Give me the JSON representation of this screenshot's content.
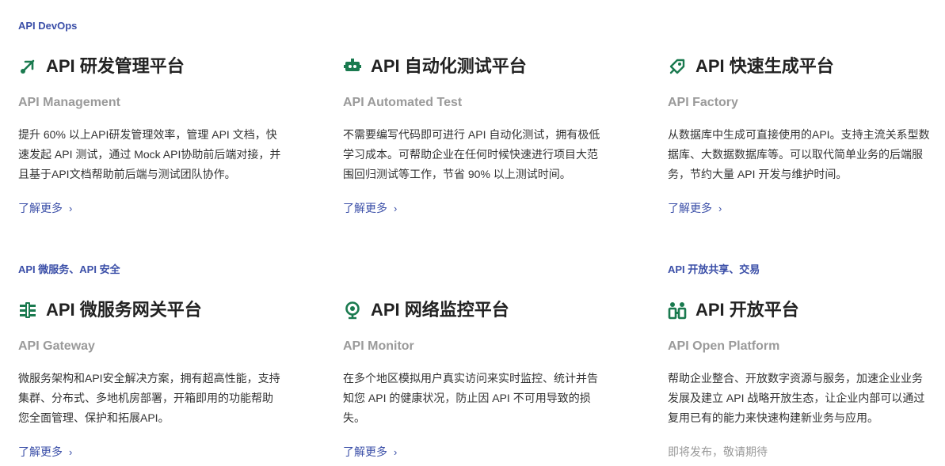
{
  "colors": {
    "accent": "#3b4fa8",
    "icon_green": "#1a7a4f",
    "title": "#222222",
    "subtitle": "#9a9a9a",
    "muted": "#999999"
  },
  "categories": {
    "devops": "API DevOps",
    "micro": "API 微服务、API 安全",
    "open": "API 开放共享、交易"
  },
  "cards": [
    {
      "icon": "satellite-icon",
      "title": "API 研发管理平台",
      "subtitle": "API Management",
      "desc": "提升 60% 以上API研发管理效率，管理 API 文档，快速发起 API 测试，通过 Mock API协助前后端对接，并且基于API文档帮助前后端与测试团队协作。",
      "more": "了解更多",
      "more_icon": "chevron-right-icon"
    },
    {
      "icon": "robot-icon",
      "title": "API 自动化测试平台",
      "subtitle": "API Automated Test",
      "desc": "不需要编写代码即可进行 API 自动化测试，拥有极低学习成本。可帮助企业在任何时候快速进行项目大范围回归测试等工作，节省 90% 以上测试时间。",
      "more": "了解更多",
      "more_icon": "chevron-right-icon"
    },
    {
      "icon": "rocket-icon",
      "title": "API 快速生成平台",
      "subtitle": "API Factory",
      "desc": "从数据库中生成可直接使用的API。支持主流关系型数据库、大数据数据库等。可以取代简单业务的后端服务，节约大量 API 开发与维护时间。",
      "more": "了解更多",
      "more_icon": "chevron-right-icon"
    },
    {
      "icon": "gateway-icon",
      "title": "API 微服务网关平台",
      "subtitle": "API Gateway",
      "desc": "微服务架构和API安全解决方案，拥有超高性能，支持集群、分布式、多地机房部署，开箱即用的功能帮助您全面管理、保护和拓展API。",
      "more": "了解更多",
      "more_icon": "chevron-right-icon"
    },
    {
      "icon": "monitor-pin-icon",
      "title": "API 网络监控平台",
      "subtitle": "API Monitor",
      "desc": "在多个地区模拟用户真实访问来实时监控、统计并告知您 API 的健康状况，防止因 API 不可用导致的损失。",
      "more": "了解更多",
      "more_icon": "chevron-right-icon"
    },
    {
      "icon": "open-platform-icon",
      "title": "API 开放平台",
      "subtitle": "API Open Platform",
      "desc": "帮助企业整合、开放数字资源与服务，加速企业业务发展及建立 API 战略开放生态，让企业内部可以通过复用已有的能力来快速构建新业务与应用。",
      "more": "即将发布，敬请期待"
    }
  ]
}
